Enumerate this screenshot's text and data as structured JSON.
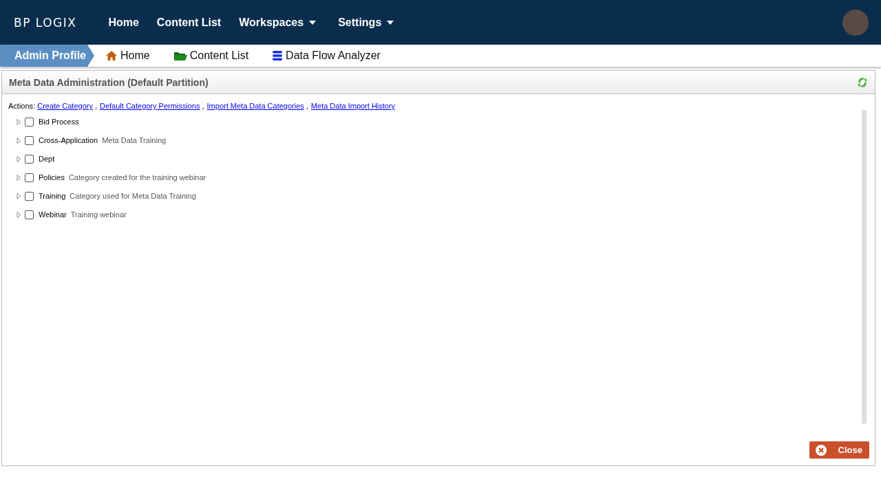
{
  "logo": {
    "text": "BP LOGIX"
  },
  "nav": [
    {
      "label": "Home",
      "dropdown": false
    },
    {
      "label": "Content List",
      "dropdown": false
    },
    {
      "label": "Workspaces",
      "dropdown": true
    },
    {
      "label": "Settings",
      "dropdown": true
    }
  ],
  "breadcrumb": {
    "current": "Admin Profile",
    "links": [
      {
        "label": "Home",
        "kind": "home"
      },
      {
        "label": "Content List",
        "kind": "folder"
      },
      {
        "label": "Data Flow Analyzer",
        "kind": "database"
      }
    ]
  },
  "panel": {
    "title": "Meta Data Administration (Default Partition)",
    "actions_label": "Actions:",
    "action_separator": ",",
    "actions": [
      "Create Category",
      "Default Category Permissions",
      "Import Meta Data Categories",
      "Meta Data Import History"
    ],
    "tree": [
      {
        "name": "Bid Process",
        "checked": false,
        "expanded": false
      },
      {
        "name": "Cross-Application",
        "description": "Meta Data Training",
        "checked": false,
        "expanded": false
      },
      {
        "name": "Dept",
        "checked": false,
        "expanded": false
      },
      {
        "name": "Policies",
        "description": "Category created for the training webinar",
        "checked": false,
        "expanded": false
      },
      {
        "name": "Training",
        "description": "Category used for Meta Data Training",
        "checked": false,
        "expanded": false
      },
      {
        "name": "Webinar",
        "description": "Training webinar",
        "checked": false,
        "expanded": false
      }
    ],
    "close_button": "Close"
  }
}
